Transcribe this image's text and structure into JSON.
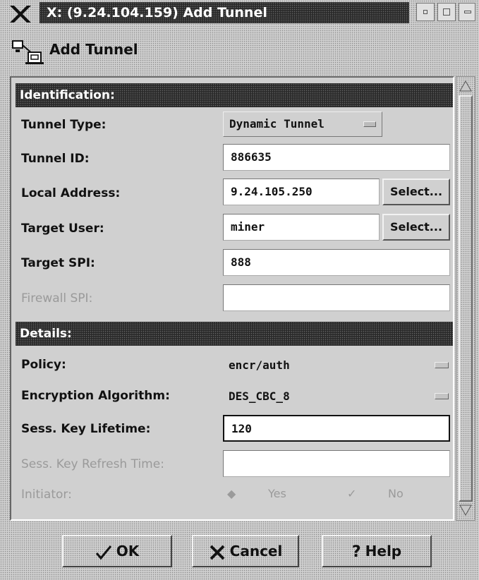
{
  "window": {
    "title": "X: (9.24.104.159) Add Tunnel"
  },
  "header": {
    "title": "Add Tunnel",
    "icon": "tunnel-icon"
  },
  "identification": {
    "section_label": "Identification:",
    "tunnel_type": {
      "label": "Tunnel Type:",
      "value": "Dynamic Tunnel"
    },
    "tunnel_id": {
      "label": "Tunnel ID:",
      "value": "886635"
    },
    "local_address": {
      "label": "Local Address:",
      "value": "9.24.105.250",
      "button": "Select..."
    },
    "target_user": {
      "label": "Target User:",
      "value": "miner",
      "button": "Select..."
    },
    "target_spi": {
      "label": "Target SPI:",
      "value": "888"
    },
    "firewall_spi": {
      "label": "Firewall SPI:",
      "value": ""
    }
  },
  "details": {
    "section_label": "Details:",
    "policy": {
      "label": "Policy:",
      "value": "encr/auth"
    },
    "encryption_algorithm": {
      "label": "Encryption Algorithm:",
      "value": "DES_CBC_8"
    },
    "sess_key_lifetime": {
      "label": "Sess. Key Lifetime:",
      "value": "120"
    },
    "sess_key_refresh_time": {
      "label": "Sess. Key Refresh Time:",
      "value": ""
    },
    "initiator": {
      "label": "Initiator:",
      "yes": "Yes",
      "no": "No"
    }
  },
  "buttons": {
    "ok": "OK",
    "cancel": "Cancel",
    "help": "Help"
  }
}
